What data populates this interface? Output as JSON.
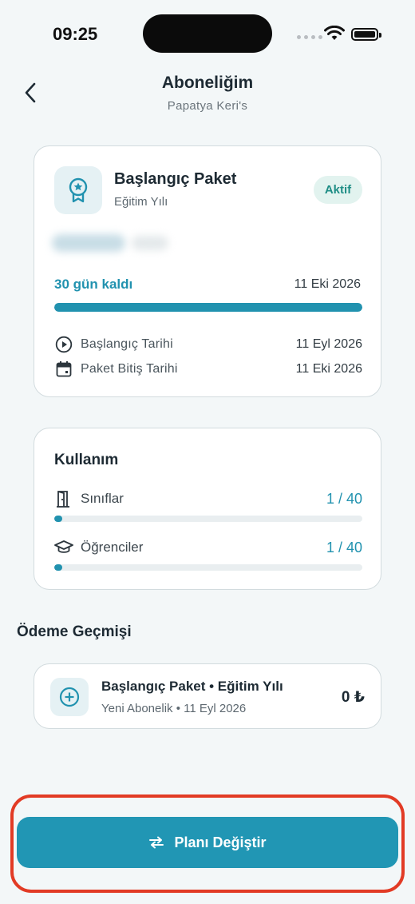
{
  "status_bar": {
    "time": "09:25"
  },
  "header": {
    "title": "Aboneliğim",
    "subtitle": "Papatya Keri's"
  },
  "plan": {
    "name": "Başlangıç Paket",
    "period": "Eğitim Yılı",
    "status": "Aktif",
    "remaining_label": "30 gün kaldı",
    "end_date": "11 Eki 2026",
    "progress_fraction": 1.0,
    "start_label": "Başlangıç Tarihi",
    "start_value": "11 Eyl 2026",
    "end_label": "Paket Bitiş Tarihi",
    "end_value": "11 Eki 2026"
  },
  "usage": {
    "title": "Kullanım",
    "items": [
      {
        "label": "Sınıflar",
        "value": "1 / 40",
        "used": 1,
        "total": 40
      },
      {
        "label": "Öğrenciler",
        "value": "1 / 40",
        "used": 1,
        "total": 40
      }
    ]
  },
  "payment_history": {
    "title": "Ödeme Geçmişi",
    "items": [
      {
        "title": "Başlangıç Paket • Eğitim Yılı",
        "meta": "Yeni Abonelik • 11 Eyl 2026",
        "amount": "0 ₺"
      }
    ]
  },
  "cta": {
    "label": "Planı Değiştir"
  },
  "colors": {
    "accent": "#2192af",
    "badge_bg": "#e2f3ef",
    "badge_text": "#1f8e86",
    "highlight": "#e23b25"
  }
}
